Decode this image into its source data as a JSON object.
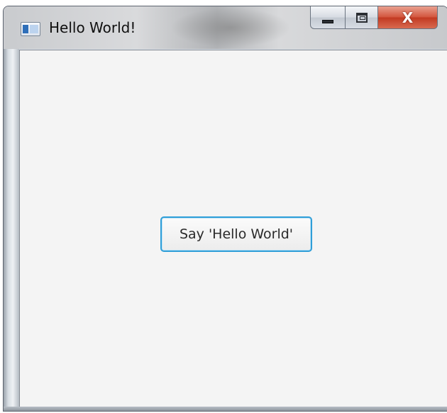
{
  "window": {
    "title": "Hello World!",
    "icon": "app-window-icon",
    "controls": {
      "minimize_icon": "minimize-icon",
      "maximize_icon": "maximize-icon",
      "close_label": "X"
    }
  },
  "main": {
    "button_label": "Say 'Hello World'"
  },
  "colors": {
    "client_background": "#f4f4f4",
    "button_focus_border": "#2f9ed8",
    "close_button": "#c94a31"
  }
}
